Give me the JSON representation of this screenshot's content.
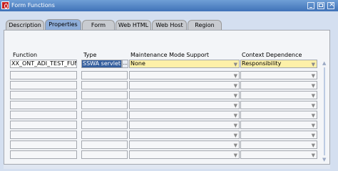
{
  "window": {
    "title": "Form Functions"
  },
  "tabs": [
    {
      "label": "Description"
    },
    {
      "label": "Properties"
    },
    {
      "label": "Form"
    },
    {
      "label": "Web HTML"
    },
    {
      "label": "Web Host"
    },
    {
      "label": "Region"
    }
  ],
  "active_tab": "Properties",
  "columns": {
    "function": "Function",
    "type": "Type",
    "maintenance": "Maintenance Mode Support",
    "context": "Context Dependence"
  },
  "row1": {
    "function": "XX_ONT_ADI_TEST_FUN",
    "type": "SSWA servlet",
    "lov": "...",
    "maintenance": "None",
    "context": "Responsibility"
  },
  "icons": {
    "dropdown": "chevron-down-icon",
    "scroll_up": "scroll-up-icon",
    "scroll_down": "scroll-down-icon"
  }
}
